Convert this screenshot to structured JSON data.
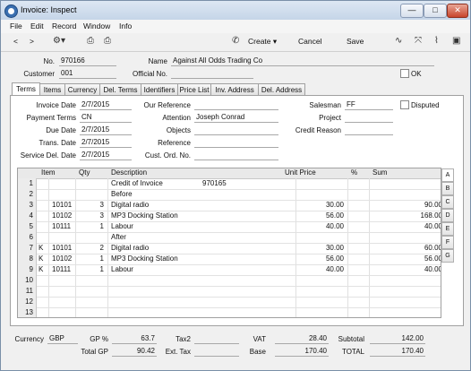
{
  "window": {
    "title": "Invoice: Inspect",
    "btn_minimize": "—",
    "btn_maximize": "□",
    "btn_close": "✕"
  },
  "menu": [
    "File",
    "Edit",
    "Record",
    "Window",
    "Info"
  ],
  "toolbar": {
    "prev": "<",
    "next": ">",
    "create": "Create",
    "cancel": "Cancel",
    "save": "Save"
  },
  "header": {
    "no_label": "No.",
    "no_value": "970166",
    "name_label": "Name",
    "name_value": "Against All Odds Trading Co",
    "customer_label": "Customer",
    "customer_value": "001",
    "official_no_label": "Official No.",
    "official_no_value": "",
    "ok_label": "OK"
  },
  "tabs": [
    "Terms",
    "Items",
    "Currency",
    "Del. Terms",
    "Identifiers",
    "Price List",
    "Inv. Address",
    "Del. Address"
  ],
  "terms": {
    "invoice_date_label": "Invoice Date",
    "invoice_date": "2/7/2015",
    "payment_terms_label": "Payment Terms",
    "payment_terms": "CN",
    "due_date_label": "Due Date",
    "due_date": "2/7/2015",
    "trans_date_label": "Trans. Date",
    "trans_date": "2/7/2015",
    "service_del_date_label": "Service Del. Date",
    "service_del_date": "2/7/2015",
    "our_reference_label": "Our Reference",
    "attention_label": "Attention",
    "attention": "Joseph Conrad",
    "objects_label": "Objects",
    "reference_label": "Reference",
    "cust_ord_no_label": "Cust. Ord. No.",
    "salesman_label": "Salesman",
    "salesman": "FF",
    "disputed_label": "Disputed",
    "project_label": "Project",
    "credit_reason_label": "Credit Reason"
  },
  "grid": {
    "columns": [
      "Item",
      "Qty",
      "Description",
      "Unit Price",
      "%",
      "Sum"
    ],
    "rows": [
      {
        "n": "1",
        "k": "",
        "item": "",
        "qty": "",
        "desc": "Credit of Invoice",
        "desc2": "970165",
        "price": "",
        "pct": "",
        "sum": ""
      },
      {
        "n": "2",
        "k": "",
        "item": "",
        "qty": "",
        "desc": "Before",
        "desc2": "",
        "price": "",
        "pct": "",
        "sum": ""
      },
      {
        "n": "3",
        "k": "",
        "item": "10101",
        "qty": "3",
        "desc": "Digital radio",
        "desc2": "",
        "price": "30.00",
        "pct": "",
        "sum": "90.00"
      },
      {
        "n": "4",
        "k": "",
        "item": "10102",
        "qty": "3",
        "desc": "MP3 Docking Station",
        "desc2": "",
        "price": "56.00",
        "pct": "",
        "sum": "168.00"
      },
      {
        "n": "5",
        "k": "",
        "item": "10111",
        "qty": "1",
        "desc": "Labour",
        "desc2": "",
        "price": "40.00",
        "pct": "",
        "sum": "40.00"
      },
      {
        "n": "6",
        "k": "",
        "item": "",
        "qty": "",
        "desc": "After",
        "desc2": "",
        "price": "",
        "pct": "",
        "sum": ""
      },
      {
        "n": "7",
        "k": "K",
        "item": "10101",
        "qty": "2",
        "desc": "Digital radio",
        "desc2": "",
        "price": "30.00",
        "pct": "",
        "sum": "60.00"
      },
      {
        "n": "8",
        "k": "K",
        "item": "10102",
        "qty": "1",
        "desc": "MP3 Docking Station",
        "desc2": "",
        "price": "56.00",
        "pct": "",
        "sum": "56.00"
      },
      {
        "n": "9",
        "k": "K",
        "item": "10111",
        "qty": "1",
        "desc": "Labour",
        "desc2": "",
        "price": "40.00",
        "pct": "",
        "sum": "40.00"
      },
      {
        "n": "10",
        "k": "",
        "item": "",
        "qty": "",
        "desc": "",
        "desc2": "",
        "price": "",
        "pct": "",
        "sum": ""
      },
      {
        "n": "11",
        "k": "",
        "item": "",
        "qty": "",
        "desc": "",
        "desc2": "",
        "price": "",
        "pct": "",
        "sum": ""
      },
      {
        "n": "12",
        "k": "",
        "item": "",
        "qty": "",
        "desc": "",
        "desc2": "",
        "price": "",
        "pct": "",
        "sum": ""
      },
      {
        "n": "13",
        "k": "",
        "item": "",
        "qty": "",
        "desc": "",
        "desc2": "",
        "price": "",
        "pct": "",
        "sum": ""
      }
    ],
    "side_buttons": [
      "A",
      "B",
      "C",
      "D",
      "E",
      "F",
      "G"
    ]
  },
  "footer": {
    "currency_label": "Currency",
    "currency": "GBP",
    "gp_pct_label": "GP %",
    "gp_pct": "63.7",
    "total_gp_label": "Total GP",
    "total_gp": "90.42",
    "tax2_label": "Tax2",
    "tax2": "",
    "ext_tax_label": "Ext. Tax",
    "ext_tax": "",
    "vat_label": "VAT",
    "vat": "28.40",
    "base_label": "Base",
    "base": "170.40",
    "subtotal_label": "Subtotal",
    "subtotal": "142.00",
    "total_label": "TOTAL",
    "total": "170.40"
  }
}
